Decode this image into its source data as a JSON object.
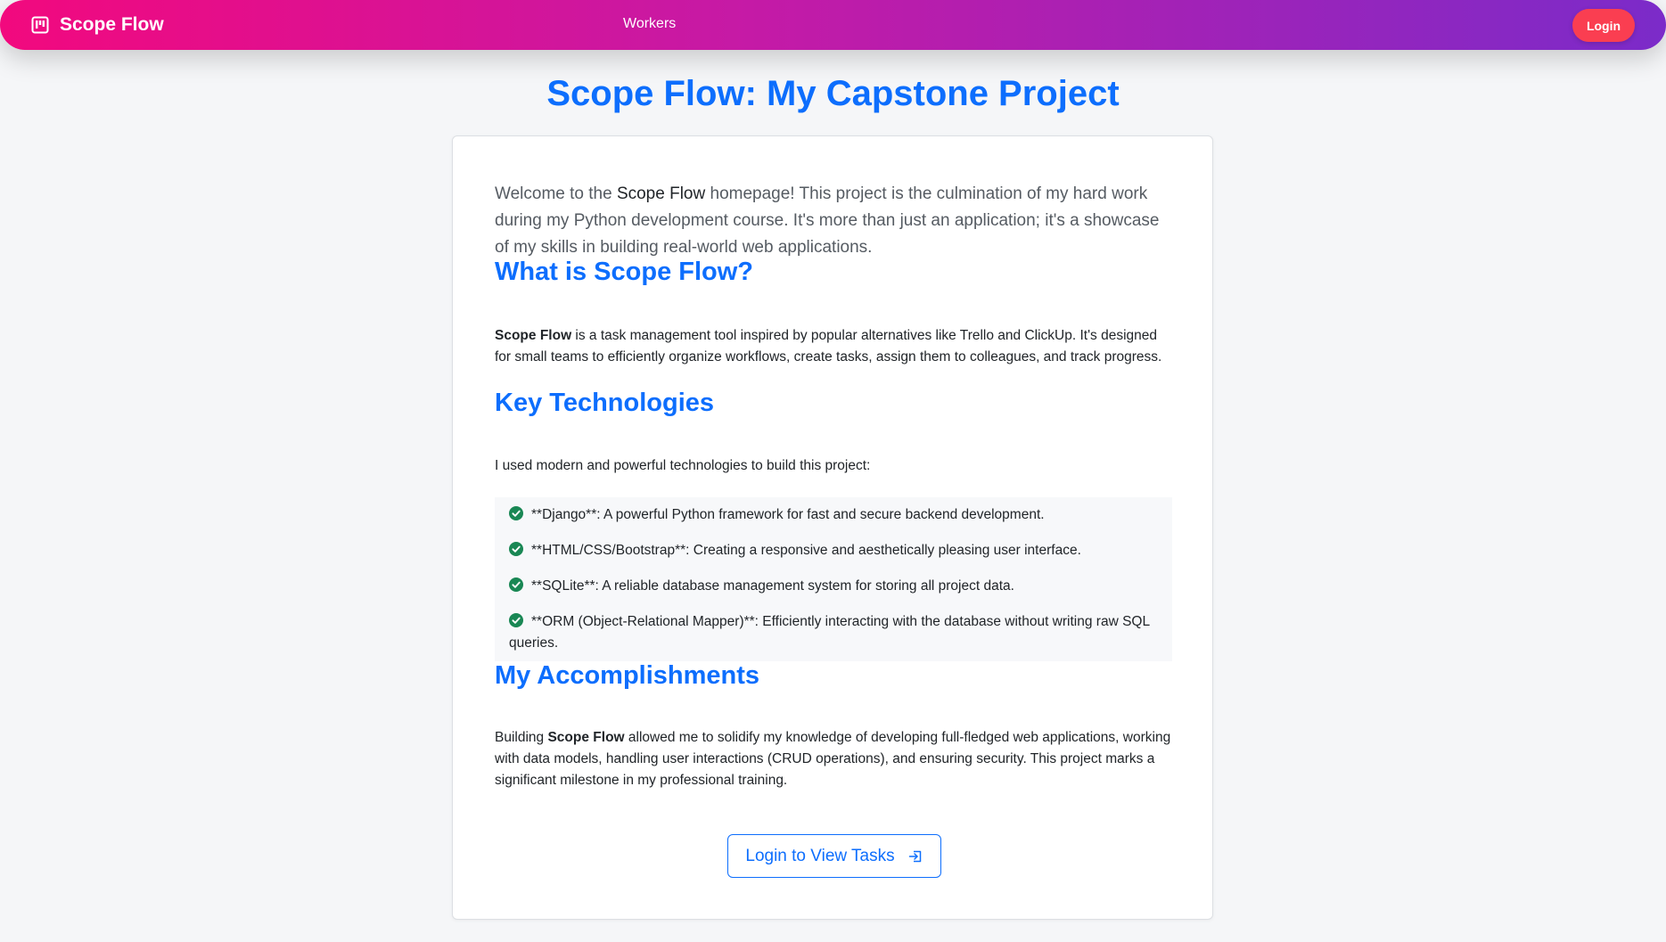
{
  "nav": {
    "brand": "Scope Flow",
    "brand_icon": "kanban-icon",
    "links": [
      "Workers"
    ],
    "login_label": "Login",
    "gradient": [
      "#f2097e",
      "#7b2bc9"
    ],
    "login_color": "#fa3e51"
  },
  "page": {
    "title": "Scope Flow: My Capstone Project",
    "accent": "#0d6efd"
  },
  "intro": {
    "before": "Welcome to the ",
    "strong": "Scope Flow",
    "after": " homepage! This project is the culmination of my hard work during my Python development course. It's more than just an application; it's a showcase of my skills in building real-world web applications."
  },
  "what": {
    "title": "What is Scope Flow?",
    "strong": "Scope Flow",
    "text": " is a task management tool inspired by popular alternatives like Trello and ClickUp. It's designed for small teams to efficiently organize workflows, create tasks, assign them to colleagues, and track progress."
  },
  "tech": {
    "title": "Key Technologies",
    "intro": "I used modern and powerful technologies to build this project:",
    "check_icon": "check-circle-icon",
    "check_color": "#198754",
    "items": [
      "**Django**: A powerful Python framework for fast and secure backend development.",
      "**HTML/CSS/Bootstrap**: Creating a responsive and aesthetically pleasing user interface.",
      "**SQLite**: A reliable database management system for storing all project data.",
      "**ORM (Object-Relational Mapper)**: Efficiently interacting with the database without writing raw SQL queries."
    ]
  },
  "accomplishments": {
    "title": "My Accomplishments",
    "before": "Building ",
    "strong": "Scope Flow",
    "after": " allowed me to solidify my knowledge of developing full-fledged web applications, working with data models, handling user interactions (CRUD operations), and ensuring security. This project marks a significant milestone in my professional training."
  },
  "cta": {
    "label": "Login to View Tasks",
    "icon": "box-arrow-in-right-icon"
  }
}
